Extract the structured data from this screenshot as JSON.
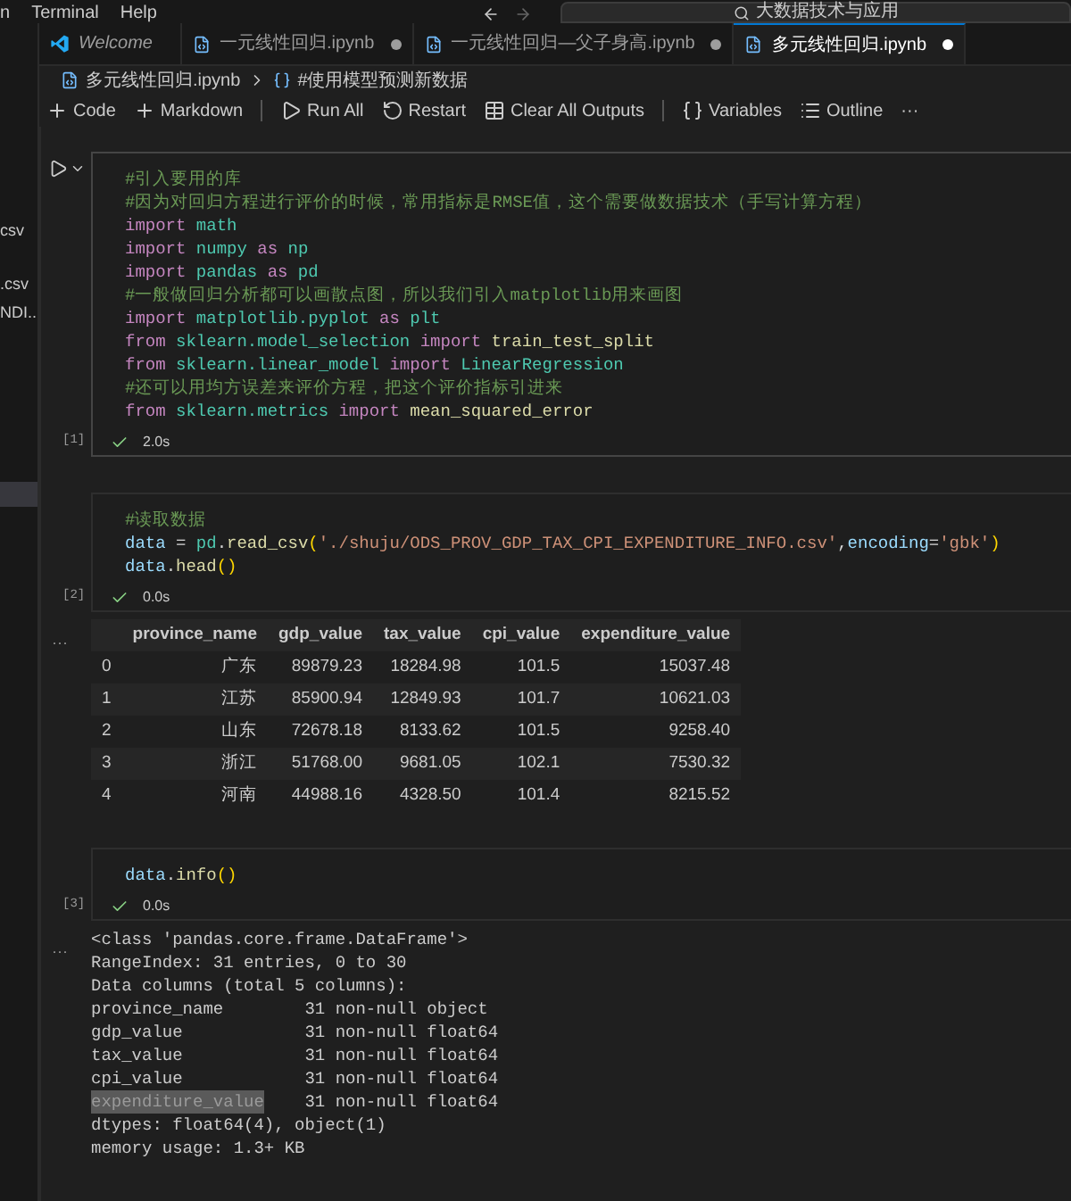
{
  "menu_bar": {
    "items": [
      "n",
      "Terminal",
      "Help"
    ],
    "search": {
      "value": "大数据技术与应用"
    }
  },
  "sidebar": {
    "items": [
      {
        "label": "csv",
        "selected": false
      },
      {
        "label": ".csv",
        "selected": false
      },
      {
        "label": "NDI...",
        "selected": false
      },
      {
        "selected": true
      }
    ]
  },
  "tabs": [
    {
      "label": "Welcome",
      "kind": "welcome",
      "selected": false,
      "modified": false
    },
    {
      "label": "一元线性回归.ipynb",
      "kind": "notebook",
      "selected": false,
      "modified": true
    },
    {
      "label": "一元线性回归—父子身高.ipynb",
      "kind": "notebook",
      "selected": false,
      "modified": true
    },
    {
      "label": "多元线性回归.ipynb",
      "kind": "notebook",
      "selected": true,
      "modified": true
    }
  ],
  "breadcrumb": [
    "多元线性回归.ipynb",
    "#使用模型预测新数据"
  ],
  "toolbar": [
    {
      "label": "Code",
      "kind": "plus"
    },
    {
      "label": "Markdown",
      "kind": "plus"
    },
    {
      "label": "Run All",
      "kind": "run"
    },
    {
      "label": "Restart",
      "kind": "restart"
    },
    {
      "label": "Clear All Outputs",
      "kind": "clear"
    },
    {
      "label": "Variables",
      "kind": "variables"
    },
    {
      "label": "Outline",
      "kind": "outline"
    },
    {
      "label": "···",
      "kind": "more"
    }
  ],
  "cells": [
    {
      "count": "[1]",
      "time": "2.0s",
      "focused": true,
      "lines": [
        [
          {
            "text": "#引入要用的库",
            "kind": "comment"
          }
        ],
        [
          {
            "text": "#因为对回归方程进行评价的时候，常用指标是RMSE值，这个需要做数据技术（手写计算方程）",
            "kind": "comment"
          }
        ],
        [
          {
            "text": "import",
            "kind": "keyword"
          },
          {
            "text": " math",
            "kind": "module"
          }
        ],
        [
          {
            "text": "import",
            "kind": "keyword"
          },
          {
            "text": " numpy ",
            "kind": "module"
          },
          {
            "text": "as",
            "kind": "keyword"
          },
          {
            "text": " np",
            "kind": "module"
          }
        ],
        [
          {
            "text": "import",
            "kind": "keyword"
          },
          {
            "text": " pandas ",
            "kind": "module"
          },
          {
            "text": "as",
            "kind": "keyword"
          },
          {
            "text": " pd",
            "kind": "module"
          }
        ],
        [
          {
            "text": "#一般做回归分析都可以画散点图，所以我们引入matplotlib用来画图",
            "kind": "comment"
          }
        ],
        [
          {
            "text": "import",
            "kind": "keyword"
          },
          {
            "text": " matplotlib.pyplot ",
            "kind": "module"
          },
          {
            "text": "as",
            "kind": "keyword"
          },
          {
            "text": " plt",
            "kind": "module"
          }
        ],
        [
          {
            "text": "from",
            "kind": "keyword"
          },
          {
            "text": " sklearn.model_selection ",
            "kind": "module"
          },
          {
            "text": "import",
            "kind": "keyword"
          },
          {
            "text": " train_test_split",
            "kind": "function"
          }
        ],
        [
          {
            "text": "from",
            "kind": "keyword"
          },
          {
            "text": " sklearn.linear_model ",
            "kind": "module"
          },
          {
            "text": "import",
            "kind": "keyword"
          },
          {
            "text": " LinearRegression",
            "kind": "module"
          }
        ],
        [
          {
            "text": "#还可以用均方误差来评价方程，把这个评价指标引进来",
            "kind": "comment"
          }
        ],
        [
          {
            "text": "from",
            "kind": "keyword"
          },
          {
            "text": " sklearn.metrics ",
            "kind": "module"
          },
          {
            "text": "import",
            "kind": "keyword"
          },
          {
            "text": " mean_squared_error",
            "kind": "function"
          }
        ]
      ]
    },
    {
      "count": "[2]",
      "time": "0.0s",
      "focused": false,
      "lines": [
        [
          {
            "text": "#读取数据",
            "kind": "comment"
          }
        ],
        [
          {
            "text": "data",
            "kind": "variable"
          },
          {
            "text": " = ",
            "kind": "plain"
          },
          {
            "text": "pd",
            "kind": "module"
          },
          {
            "text": ".",
            "kind": "plain"
          },
          {
            "text": "read_csv",
            "kind": "function"
          },
          {
            "text": "(",
            "kind": "bracket"
          },
          {
            "text": "'./shuju/ODS_PROV_GDP_TAX_CPI_EXPENDITURE_INFO.csv'",
            "kind": "string"
          },
          {
            "text": ",",
            "kind": "plain"
          },
          {
            "text": "encoding",
            "kind": "variable"
          },
          {
            "text": "=",
            "kind": "plain"
          },
          {
            "text": "'gbk'",
            "kind": "string"
          },
          {
            "text": ")",
            "kind": "bracket"
          }
        ],
        [
          {
            "text": "data",
            "kind": "variable"
          },
          {
            "text": ".",
            "kind": "plain"
          },
          {
            "text": "head",
            "kind": "function"
          },
          {
            "text": "()",
            "kind": "bracket"
          }
        ]
      ],
      "output": {
        "kind": "table",
        "marker": "···",
        "columns": [
          "province_name",
          "gdp_value",
          "tax_value",
          "cpi_value",
          "expenditure_value"
        ],
        "rows": [
          {
            "index": "0",
            "cells": [
              "广东",
              "89879.23",
              "18284.98",
              "101.5",
              "15037.48"
            ]
          },
          {
            "index": "1",
            "cells": [
              "江苏",
              "85900.94",
              "12849.93",
              "101.7",
              "10621.03"
            ]
          },
          {
            "index": "2",
            "cells": [
              "山东",
              "72678.18",
              "8133.62",
              "101.5",
              "9258.40"
            ]
          },
          {
            "index": "3",
            "cells": [
              "浙江",
              "51768.00",
              "9681.05",
              "102.1",
              "7530.32"
            ]
          },
          {
            "index": "4",
            "cells": [
              "河南",
              "44988.16",
              "4328.50",
              "101.4",
              "8215.52"
            ]
          }
        ]
      }
    },
    {
      "count": "[3]",
      "time": "0.0s",
      "focused": false,
      "lines": [
        [
          {
            "text": "data",
            "kind": "variable"
          },
          {
            "text": ".",
            "kind": "plain"
          },
          {
            "text": "info",
            "kind": "function"
          },
          {
            "text": "()",
            "kind": "bracket"
          }
        ]
      ],
      "output": {
        "kind": "info",
        "marker": "···",
        "header_lines": [
          "<class 'pandas.core.frame.DataFrame'>",
          "RangeIndex: 31 entries, 0 to 30",
          "Data columns (total 5 columns):"
        ],
        "columns": [
          {
            "name": "province_name",
            "info": "31 non-null object",
            "selected": false
          },
          {
            "name": "gdp_value",
            "info": "31 non-null float64",
            "selected": false
          },
          {
            "name": "tax_value",
            "info": "31 non-null float64",
            "selected": false
          },
          {
            "name": "cpi_value",
            "info": "31 non-null float64",
            "selected": false
          },
          {
            "name": "expenditure_value",
            "info": "31 non-null float64",
            "selected": true
          }
        ],
        "footer_lines": [
          "dtypes: float64(4), object(1)",
          "memory usage: 1.3+ KB"
        ]
      }
    }
  ]
}
